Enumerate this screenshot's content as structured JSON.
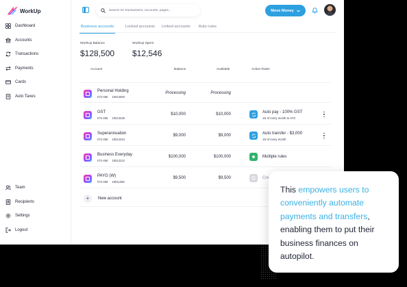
{
  "app": {
    "name": "WorkUp"
  },
  "sidebar": {
    "items": [
      {
        "label": "Dashboard",
        "icon": "grid-icon"
      },
      {
        "label": "Accounts",
        "icon": "bank-icon"
      },
      {
        "label": "Transactions",
        "icon": "refresh-icon"
      },
      {
        "label": "Payments",
        "icon": "transfer-icon"
      },
      {
        "label": "Cards",
        "icon": "card-icon"
      },
      {
        "label": "Auto Taxes",
        "icon": "document-icon"
      }
    ],
    "bottom_items": [
      {
        "label": "Team",
        "icon": "team-icon"
      },
      {
        "label": "Recipients",
        "icon": "recipients-icon"
      },
      {
        "label": "Settings",
        "icon": "gear-icon"
      },
      {
        "label": "Logout",
        "icon": "logout-icon"
      }
    ]
  },
  "topbar": {
    "search_placeholder": "Search for transactions, accounts, pages...",
    "move_money_label": "Move Money"
  },
  "tabs": [
    {
      "label": "Business accounts",
      "active": true
    },
    {
      "label": "Locked accounts",
      "active": false
    },
    {
      "label": "Linked accounts",
      "active": false
    },
    {
      "label": "Auto rules",
      "active": false
    }
  ],
  "balances": {
    "workup_balance": {
      "label": "WorkUp Balance",
      "value": "$128,500"
    },
    "workup_spent": {
      "label": "WorkUp Spent",
      "value": "$12,546"
    }
  },
  "table": {
    "headers": {
      "account": "Account",
      "balance": "Balance",
      "available": "Available",
      "active_rules": "Active Rules"
    },
    "rows": [
      {
        "name": "Personal Holding",
        "bsb": "072-456",
        "number": "10012000",
        "balance": "Processing",
        "available": "Processing",
        "rule": null
      },
      {
        "name": "GST",
        "bsb": "072-456",
        "number": "10012246",
        "balance": "$10,000",
        "available": "$10,000",
        "rule": {
          "title": "Auto pay - 100% GST",
          "sub": "1st of every month to ATO",
          "color": "#2da0e0"
        }
      },
      {
        "name": "Superannuation",
        "bsb": "072-456",
        "number": "10012344",
        "balance": "$9,000",
        "available": "$9,000",
        "rule": {
          "title": "Auto transfer - $3,000",
          "sub": "1st of every month",
          "color": "#2da0e0"
        }
      },
      {
        "name": "Business Everyday",
        "bsb": "072-456",
        "number": "10012212",
        "balance": "$100,000",
        "available": "$100,000",
        "rule": {
          "title": "Multiple rules",
          "sub": "",
          "color": "#2fb36b"
        }
      },
      {
        "name": "PAYG (W)",
        "bsb": "072-456",
        "number": "10011256",
        "balance": "$9,500",
        "available": "$9,500",
        "rule": {
          "title": "Cre",
          "sub": "",
          "color": "#d6d8dd"
        }
      }
    ],
    "new_account_label": "New account"
  },
  "callout": {
    "lead": "This",
    "highlight": "empowers users to conveniently automate payments and transfers",
    "tail": ", enabling them to put their business finances on autopilot."
  },
  "colors": {
    "accent": "#2da0e0",
    "highlight_text": "#38b1e5"
  }
}
